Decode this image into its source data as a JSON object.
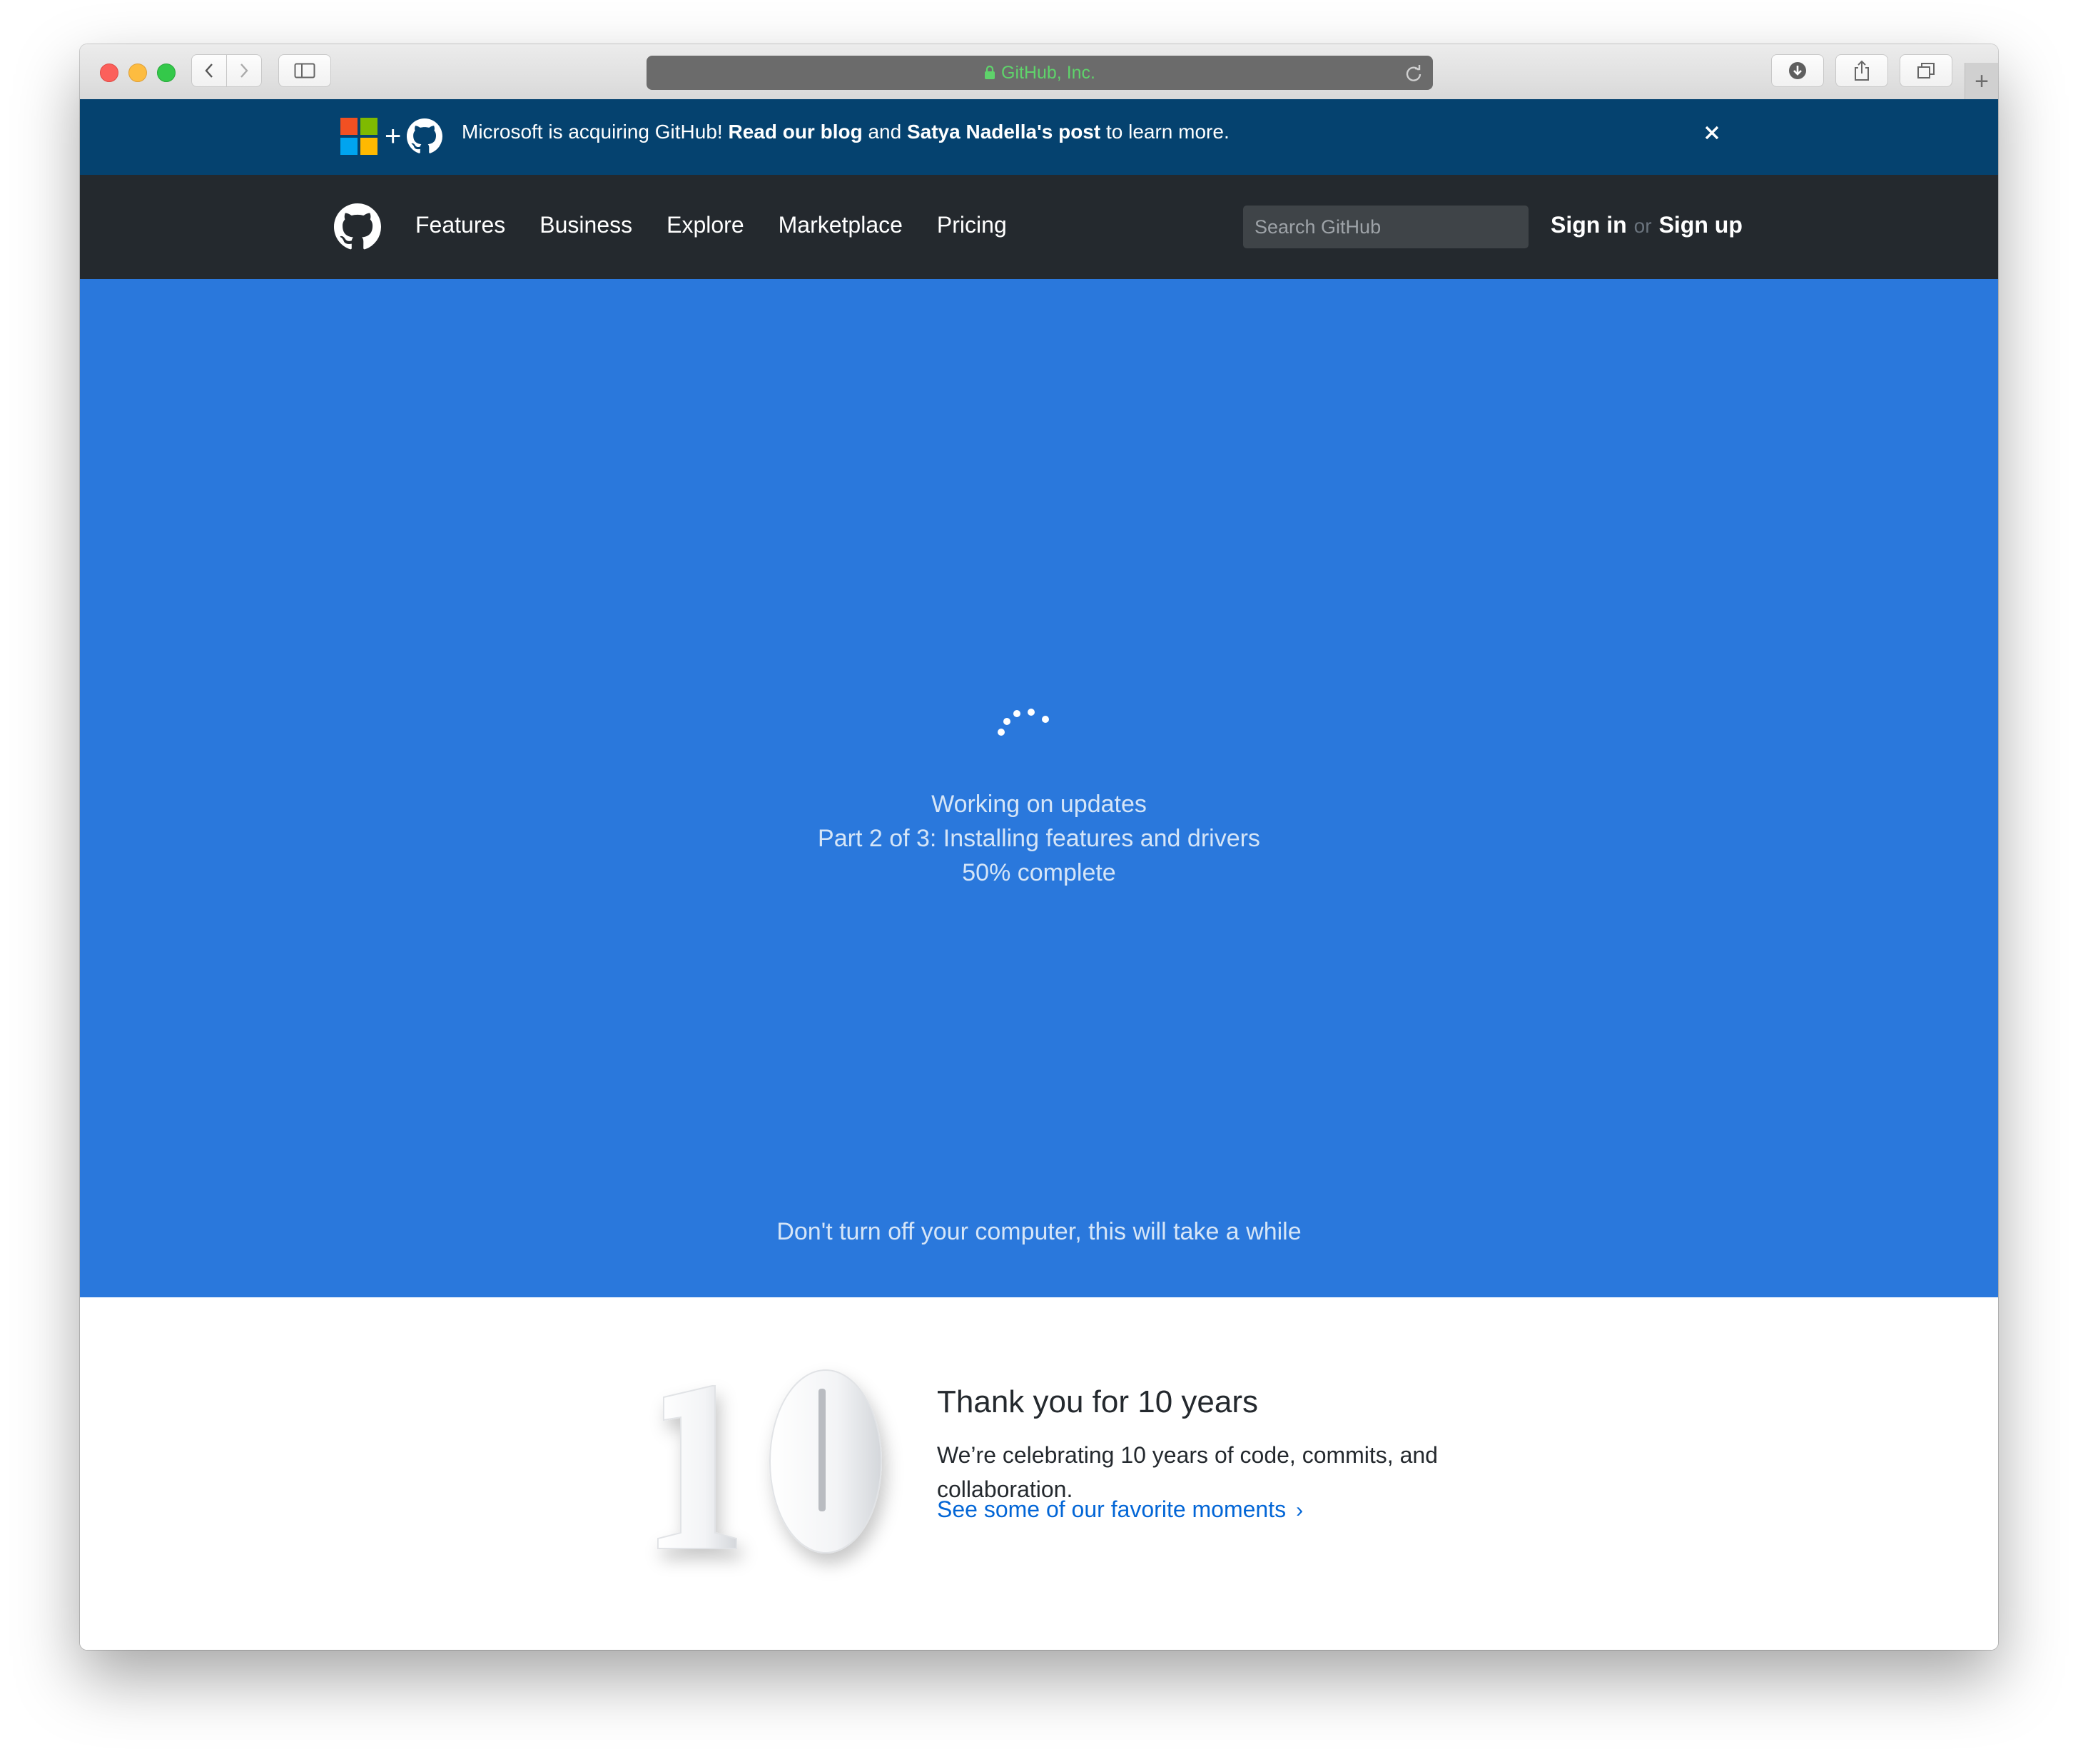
{
  "browser": {
    "address": "GitHub, Inc."
  },
  "banner": {
    "text_lead": "Microsoft is acquiring GitHub!",
    "link_blog": "Read our blog",
    "text_and": "and",
    "link_post": "Satya Nadella's post",
    "text_tail": "to learn more.",
    "close_glyph": "✕"
  },
  "header": {
    "nav": [
      "Features",
      "Business",
      "Explore",
      "Marketplace",
      "Pricing"
    ],
    "search_placeholder": "Search GitHub",
    "sign_in": "Sign in",
    "or": "or",
    "sign_up": "Sign up"
  },
  "hero": {
    "line1": "Working on updates",
    "line2": "Part 2 of 3: Installing features and drivers",
    "line3": "50% complete",
    "progress_percent": 50,
    "warning": "Don't turn off your computer, this will take a while"
  },
  "thanks": {
    "number": "10",
    "title": "Thank you for 10 years",
    "body": "We’re celebrating 10 years of code, commits, and collaboration.",
    "link": "See some of our favorite moments",
    "chevron": "›"
  },
  "colors": {
    "banner_bg": "#05426f",
    "header_bg": "#24292e",
    "hero_bg": "#2a78dc",
    "link": "#0366d6",
    "secure_green": "#5fd36b"
  }
}
